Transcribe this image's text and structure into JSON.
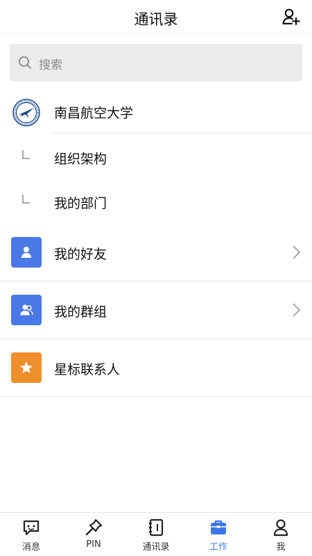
{
  "header": {
    "title": "通讯录",
    "add_icon": "add-contact-icon"
  },
  "search": {
    "placeholder": "搜索",
    "icon": "search-icon"
  },
  "organization": {
    "name": "南昌航空大学",
    "logo": "university-logo"
  },
  "org_children": [
    {
      "label": "组织架构"
    },
    {
      "label": "我的部门"
    }
  ],
  "menu": [
    {
      "label": "我的好友",
      "icon": "person-icon",
      "color": "#4a78e6",
      "has_chevron": true
    },
    {
      "label": "我的群组",
      "icon": "group-icon",
      "color": "#4a78e6",
      "has_chevron": true
    },
    {
      "label": "星标联系人",
      "icon": "star-icon",
      "color": "#ee8f2c",
      "has_chevron": false
    }
  ],
  "tabbar": {
    "items": [
      {
        "label": "消息",
        "icon": "message-icon"
      },
      {
        "label": "PIN",
        "icon": "pin-icon"
      },
      {
        "label": "通讯录",
        "icon": "contacts-book-icon"
      },
      {
        "label": "工作",
        "icon": "briefcase-icon",
        "active": true
      },
      {
        "label": "我",
        "icon": "profile-icon"
      }
    ],
    "active_color": "#3a78e8"
  }
}
